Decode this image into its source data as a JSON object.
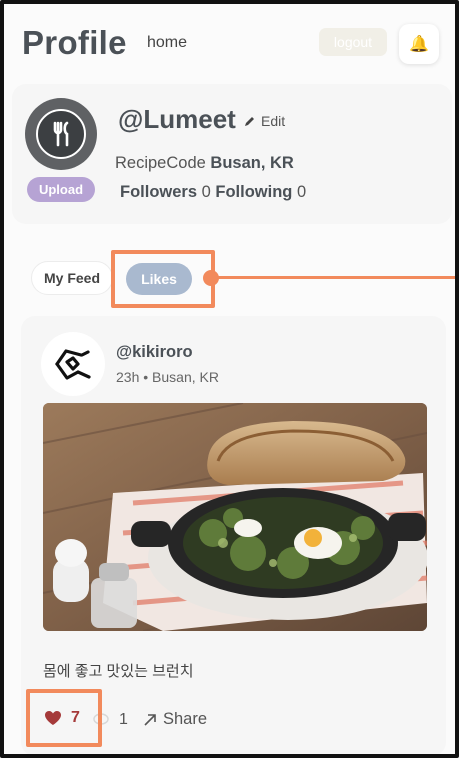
{
  "header": {
    "title": "Profile",
    "home_link": "home",
    "logout_label": "logout",
    "bell_icon": "bell-icon"
  },
  "profile": {
    "avatar_icon": "fork-knife-icon",
    "upload_label": "Upload",
    "username": "@Lumeet",
    "edit_label": "Edit",
    "site_name": "RecipeCode",
    "location": "Busan, KR",
    "followers_label": "Followers",
    "followers_count": "0",
    "following_label": "Following",
    "following_count": "0"
  },
  "tabs": [
    {
      "label": "My Feed",
      "active": false
    },
    {
      "label": "Likes",
      "active": true
    }
  ],
  "post": {
    "username": "@kikiroro",
    "time": "23h",
    "location": "Busan, KR",
    "caption": "몸에 좋고 맛있는 브런치",
    "like_count": "7",
    "comment_count": "1",
    "share_label": "Share",
    "accent": "#a53a3a"
  },
  "colors": {
    "highlight": "#f28a5c",
    "likes_tab": "#a9b9cf",
    "upload_button": "#b6a3d4"
  }
}
